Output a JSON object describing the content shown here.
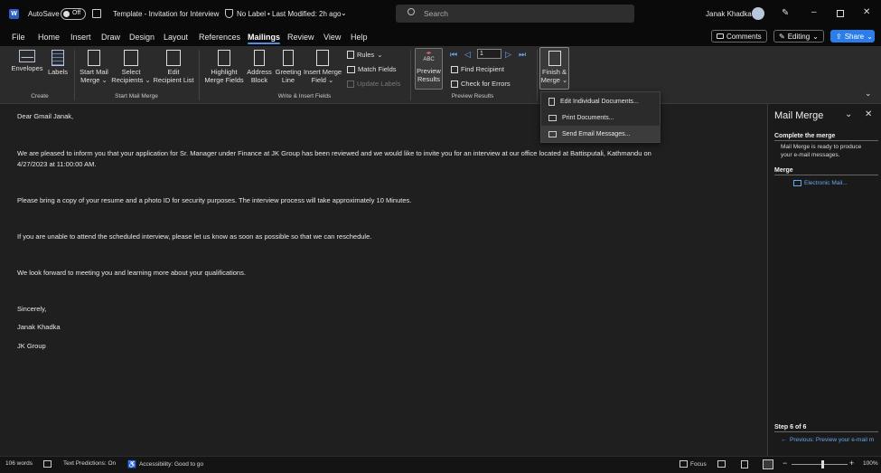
{
  "titlebar": {
    "app_icon": "word-icon",
    "autosave_label": "AutoSave",
    "autosave_state": "Off",
    "document_title": "Template - Invitation for Interview",
    "sensitivity": "No Label",
    "modified": "Last Modified: 2h ago",
    "search_placeholder": "Search",
    "user_name": "Janak Khadka"
  },
  "menubar": {
    "tabs": [
      "File",
      "Home",
      "Insert",
      "Draw",
      "Design",
      "Layout",
      "References",
      "Mailings",
      "Review",
      "View",
      "Help"
    ],
    "active_tab": "Mailings",
    "comments_label": "Comments",
    "editing_label": "Editing",
    "share_label": "Share"
  },
  "ribbon": {
    "create": {
      "group_label": "Create",
      "envelopes": "Envelopes",
      "labels": "Labels"
    },
    "start_mail_merge": {
      "group_label": "Start Mail Merge",
      "start_line1": "Start Mail",
      "start_line2": "Merge",
      "select_line1": "Select",
      "select_line2": "Recipients",
      "edit_line1": "Edit",
      "edit_line2": "Recipient List"
    },
    "write_insert": {
      "group_label": "Write & Insert Fields",
      "highlight_line1": "Highlight",
      "highlight_line2": "Merge Fields",
      "address_line1": "Address",
      "address_line2": "Block",
      "greeting_line1": "Greeting",
      "greeting_line2": "Line",
      "insert_line1": "Insert Merge",
      "insert_line2": "Field",
      "rules": "Rules",
      "match_fields": "Match Fields",
      "update_labels": "Update Labels"
    },
    "preview": {
      "group_label": "Preview Results",
      "preview_line1": "Preview",
      "preview_line2": "Results",
      "abc": "ABC",
      "record_number": "1",
      "find_recipient": "Find Recipient",
      "check_errors": "Check for Errors"
    },
    "finish": {
      "finish_line1": "Finish &",
      "finish_line2": "Merge"
    }
  },
  "finish_menu": {
    "items": [
      "Edit Individual Documents...",
      "Print Documents...",
      "Send Email Messages..."
    ]
  },
  "document": {
    "greeting": "Dear Gmail Janak,",
    "para1_line1": "We are pleased to inform you that your application for Sr. Manager under Finance at JK Group has been reviewed and we would like to invite you for an interview at our office located at Battisputali, Kathmandu on",
    "para1_line2": "4/27/2023 at 11:00:00 AM.",
    "para2": "Please bring a copy of your resume and a photo ID for security purposes. The interview process will take approximately 10 Minutes.",
    "para3": "If you are unable to attend the scheduled interview, please let us know as soon as possible so that we can reschedule.",
    "para4": "We look forward to meeting you and learning more about your qualifications.",
    "closing": "Sincerely,",
    "signer": "Janak Khadka",
    "company": "JK Group"
  },
  "pane": {
    "title": "Mail Merge",
    "complete_heading": "Complete the merge",
    "complete_text_line1": "Mail Merge is ready to produce",
    "complete_text_line2": "your e-mail messages.",
    "merge_heading": "Merge",
    "electronic_mail": "Electronic Mail...",
    "step": "Step 6 of 6",
    "previous": "Previous: Preview your e-mail m"
  },
  "statusbar": {
    "words": "106 words",
    "text_predictions": "Text Predictions: On",
    "accessibility": "Accessibility: Good to go",
    "focus": "Focus",
    "zoom": "100%",
    "zoom_level": 0.55
  },
  "colors": {
    "accent": "#4e8ee8",
    "share_button": "#2b7de9",
    "link": "#6aa6f0"
  }
}
